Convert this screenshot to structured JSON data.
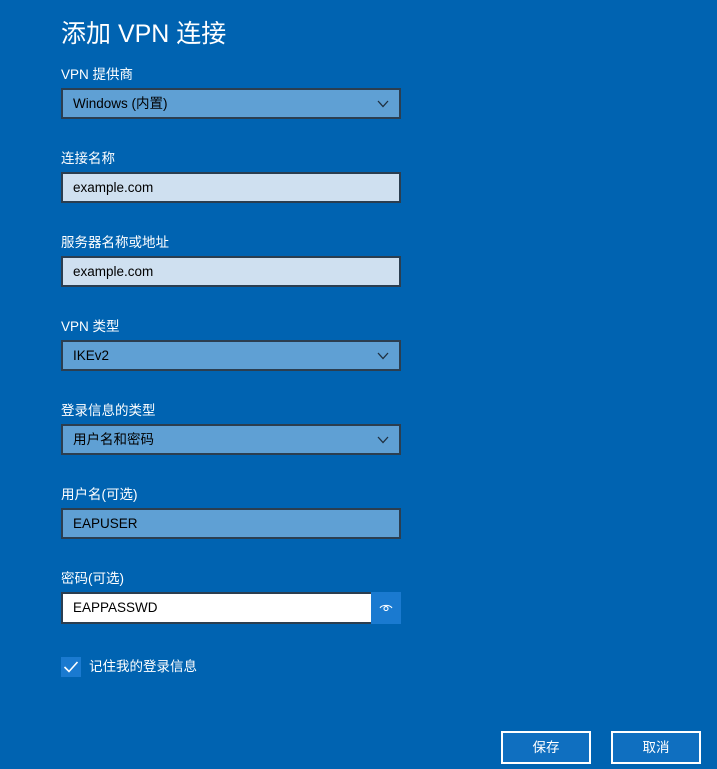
{
  "dialog": {
    "title": "添加 VPN 连接"
  },
  "fields": {
    "provider": {
      "label": "VPN 提供商",
      "value": "Windows (内置)"
    },
    "connection_name": {
      "label": "连接名称",
      "value": "example.com"
    },
    "server": {
      "label": "服务器名称或地址",
      "value": "example.com"
    },
    "vpn_type": {
      "label": "VPN 类型",
      "value": "IKEv2"
    },
    "signin_type": {
      "label": "登录信息的类型",
      "value": "用户名和密码"
    },
    "username": {
      "label": "用户名(可选)",
      "value": "EAPUSER"
    },
    "password": {
      "label": "密码(可选)",
      "value": "EAPPASSWD"
    }
  },
  "remember": {
    "label": "记住我的登录信息",
    "checked": true
  },
  "buttons": {
    "save": "保存",
    "cancel": "取消"
  },
  "icons": {
    "dropdown": "chevron-down-icon",
    "reveal": "eye-icon",
    "check": "checkmark-icon"
  },
  "colors": {
    "background": "#0063b1",
    "accent": "#1a7ad0"
  }
}
